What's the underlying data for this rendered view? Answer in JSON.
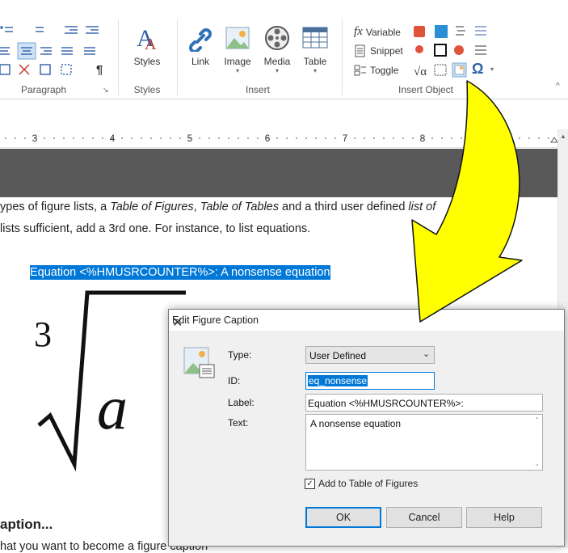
{
  "ribbon": {
    "groups": {
      "paragraph": "Paragraph",
      "styles": "Styles",
      "insert": "Insert",
      "insert_object": "Insert Object"
    },
    "styles_btn": "Styles",
    "insert_buttons": [
      "Link",
      "Image",
      "Media",
      "Table"
    ],
    "object_buttons": {
      "variable": "Variable",
      "snippet": "Snippet",
      "toggle": "Toggle"
    },
    "symbol": "Ω",
    "pilcrow": "¶"
  },
  "ruler": {
    "ticks": [
      "3",
      "4",
      "5",
      "6",
      "7",
      "8"
    ]
  },
  "document": {
    "line1_a": "ypes of figure lists, a ",
    "line1_b": "Table of Figures",
    "line1_c": ", ",
    "line1_d": "Table of Tables",
    "line1_e": " and a third user defined ",
    "line1_f": "list of",
    "line2": "lists sufficient, add a 3rd one. For instance, to list equations.",
    "selected_caption": "Equation <%HMUSRCOUNTER%>: A nonsense equation",
    "radical_index": "3",
    "radicand": "a",
    "heading": "aption...",
    "bottom_line": "hat you want to become a figure caption"
  },
  "dialog": {
    "title": "Edit Figure Caption",
    "type_label": "Type:",
    "type_value": "User Defined",
    "id_label": "ID:",
    "id_value": "eq_nonsense",
    "label_label": "Label:",
    "label_value": "Equation <%HMUSRCOUNTER%>:",
    "text_label": "Text:",
    "text_value": "A nonsense equation",
    "checkbox_label": "Add to Table of Figures",
    "checkbox_checked": true,
    "ok": "OK",
    "cancel": "Cancel",
    "help": "Help"
  },
  "colors": {
    "accent": "#0078d7",
    "arrow": "#ffff00",
    "dark_band": "#595959"
  }
}
